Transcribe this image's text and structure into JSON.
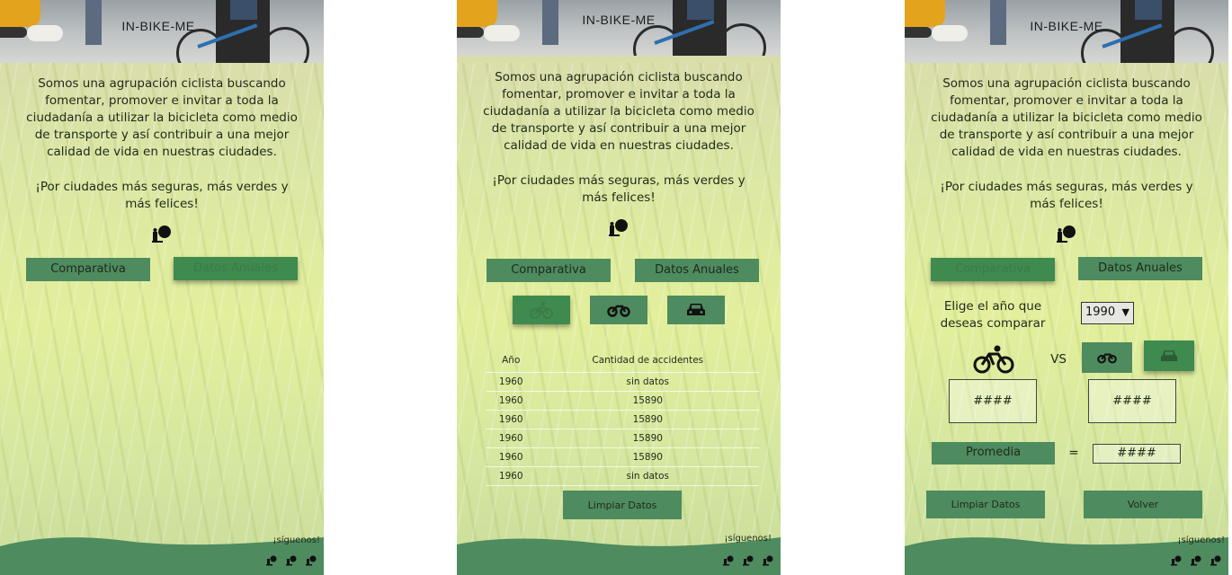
{
  "brand": "IN-BIKE-ME",
  "intro": "Somos una agrupación ciclista buscando fomentar, promover e invitar a toda la ciudadanía a utilizar la bicicleta como medio de transporte y así contribuir a una mejor calidad de vida en nuestras ciudades.",
  "slogan": "¡Por ciudades más seguras, más verdes y más felices!",
  "nav": {
    "comparativa": "Comparativa",
    "datos_anuales": "Datos Anuales"
  },
  "screen2": {
    "table": {
      "headers": [
        "Año",
        "Cantidad de accidentes"
      ],
      "rows": [
        [
          "1960",
          "sin datos"
        ],
        [
          "1960",
          "15890"
        ],
        [
          "1960",
          "15890"
        ],
        [
          "1960",
          "15890"
        ],
        [
          "1960",
          "15890"
        ],
        [
          "1960",
          "sin datos"
        ]
      ]
    },
    "clear_label": "Limpiar Datos"
  },
  "screen3": {
    "year_prompt": "Elige el año que deseas comparar",
    "year_selected": "1990",
    "vs_label": "VS",
    "value_left": "####",
    "value_right": "####",
    "average_label": "Promedia",
    "equals": "=",
    "average_value": "####",
    "clear_label": "Limpiar Datos",
    "back_label": "Volver"
  },
  "footer": {
    "follow": "¡síguenos!"
  },
  "colors": {
    "button": "#4e8b5f",
    "footer": "#4e8b5f",
    "accent_dark": "#3f8a4f"
  }
}
